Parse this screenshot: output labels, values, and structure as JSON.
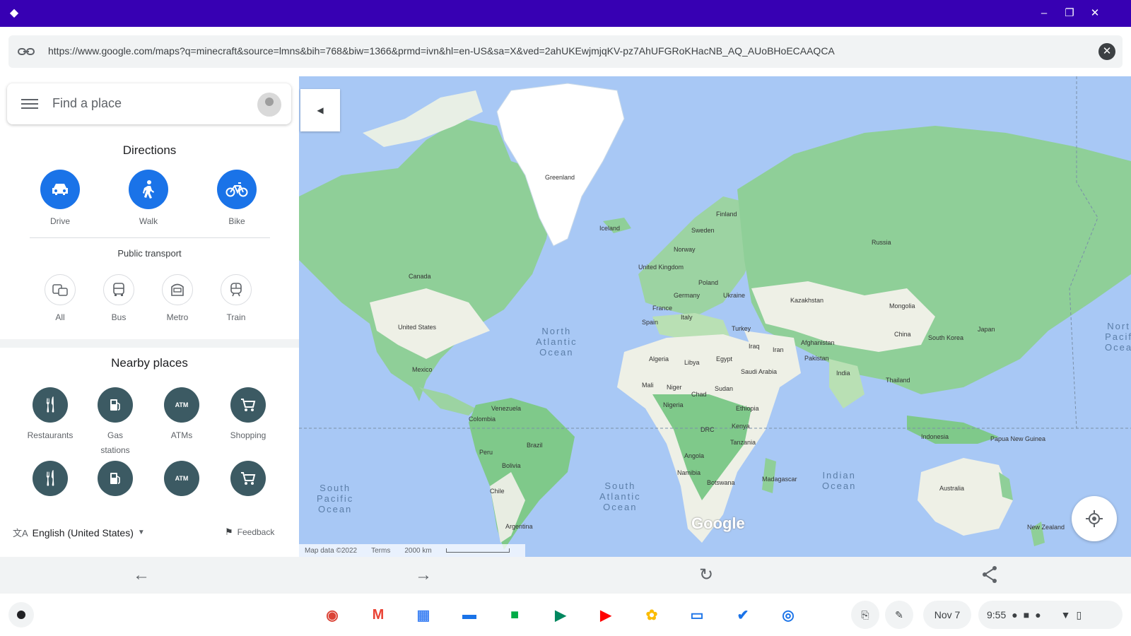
{
  "titlebar": {
    "back_icon": "arrow-back-icon"
  },
  "address_bar": {
    "url": "https://www.google.com/maps?q=minecraft&source=lmns&bih=768&biw=1366&prmd=ivn&hl=en-US&sa=X&ved=2ahUKEwjmjqKV-pz7AhUFGRoKHacNB_AQ_AUoBHoECAAQCA"
  },
  "search": {
    "placeholder": "Find a place"
  },
  "directions": {
    "title": "Directions",
    "modes": [
      {
        "label": "Drive",
        "icon": "car-icon"
      },
      {
        "label": "Walk",
        "icon": "walk-icon"
      },
      {
        "label": "Bike",
        "icon": "bike-icon"
      }
    ]
  },
  "public_transport": {
    "title": "Public transport",
    "modes": [
      {
        "label": "All",
        "icon": "transit-all-icon"
      },
      {
        "label": "Bus",
        "icon": "bus-icon"
      },
      {
        "label": "Metro",
        "icon": "metro-icon"
      },
      {
        "label": "Train",
        "icon": "train-icon"
      }
    ]
  },
  "nearby": {
    "title": "Nearby places",
    "row1": [
      {
        "label": "Restaurants",
        "icon": "restaurant-icon"
      },
      {
        "label": "Gas stations",
        "icon": "gas-station-icon"
      },
      {
        "label": "ATMs",
        "icon": "atm-icon"
      },
      {
        "label": "Shopping",
        "icon": "shopping-cart-icon"
      }
    ]
  },
  "footer": {
    "language": "English (United States)",
    "feedback": "Feedback"
  },
  "map": {
    "attribution": "Map data ©2022",
    "terms": "Terms",
    "scale": "2000 km",
    "logo": "Google",
    "labels": {
      "greenland": "Greenland",
      "iceland": "Iceland",
      "canada": "Canada",
      "usa": "United States",
      "mexico": "Mexico",
      "venezuela": "Venezuela",
      "colombia": "Colombia",
      "peru": "Peru",
      "brazil": "Brazil",
      "bolivia": "Bolivia",
      "chile": "Chile",
      "argentina": "Argentina",
      "finland": "Finland",
      "sweden": "Sweden",
      "norway": "Norway",
      "uk": "United Kingdom",
      "poland": "Poland",
      "germany": "Germany",
      "ukraine": "Ukraine",
      "france": "France",
      "spain": "Spain",
      "italy": "Italy",
      "turkey": "Turkey",
      "russia": "Russia",
      "kazakhstan": "Kazakhstan",
      "mongolia": "Mongolia",
      "china": "China",
      "iraq": "Iraq",
      "iran": "Iran",
      "afghanistan": "Afghanistan",
      "pakistan": "Pakistan",
      "india": "India",
      "thailand": "Thailand",
      "japan": "Japan",
      "south_korea": "South Korea",
      "algeria": "Algeria",
      "libya": "Libya",
      "egypt": "Egypt",
      "saudi": "Saudi Arabia",
      "mali": "Mali",
      "niger": "Niger",
      "chad": "Chad",
      "sudan": "Sudan",
      "nigeria": "Nigeria",
      "ethiopia": "Ethiopia",
      "drc": "DRC",
      "kenya": "Kenya",
      "tanzania": "Tanzania",
      "angola": "Angola",
      "namibia": "Namibia",
      "botswana": "Botswana",
      "madagascar": "Madagascar",
      "indonesia": "Indonesia",
      "png": "Papua New Guinea",
      "australia": "Australia",
      "nz": "New Zealand"
    },
    "oceans": {
      "north_atlantic": "North\nAtlantic\nOcean",
      "south_atlantic": "South\nAtlantic\nOcean",
      "south_pacific": "South\nPacific\nOcean",
      "indian": "Indian\nOcean",
      "north_pacific": "Nort\nPacif\nOcea"
    }
  },
  "shelf": {
    "date": "Nov 7",
    "time": "9:55",
    "apps": [
      {
        "name": "chrome-icon",
        "glyph": "◉",
        "color": "#db4437"
      },
      {
        "name": "gmail-icon",
        "glyph": "M",
        "color": "#ea4335"
      },
      {
        "name": "calendar-icon",
        "glyph": "▦",
        "color": "#4285f4"
      },
      {
        "name": "files-icon",
        "glyph": "▬",
        "color": "#1a73e8"
      },
      {
        "name": "meet-icon",
        "glyph": "■",
        "color": "#00ac47"
      },
      {
        "name": "play-store-icon",
        "glyph": "▶",
        "color": "#01875f"
      },
      {
        "name": "youtube-icon",
        "glyph": "▶",
        "color": "#ff0000"
      },
      {
        "name": "photos-icon",
        "glyph": "✿",
        "color": "#fbbc04"
      },
      {
        "name": "messages-icon",
        "glyph": "▭",
        "color": "#1a73e8"
      },
      {
        "name": "tasks-icon",
        "glyph": "✔",
        "color": "#1a73e8"
      },
      {
        "name": "maps-app-icon",
        "glyph": "◎",
        "color": "#1a73e8"
      }
    ]
  }
}
